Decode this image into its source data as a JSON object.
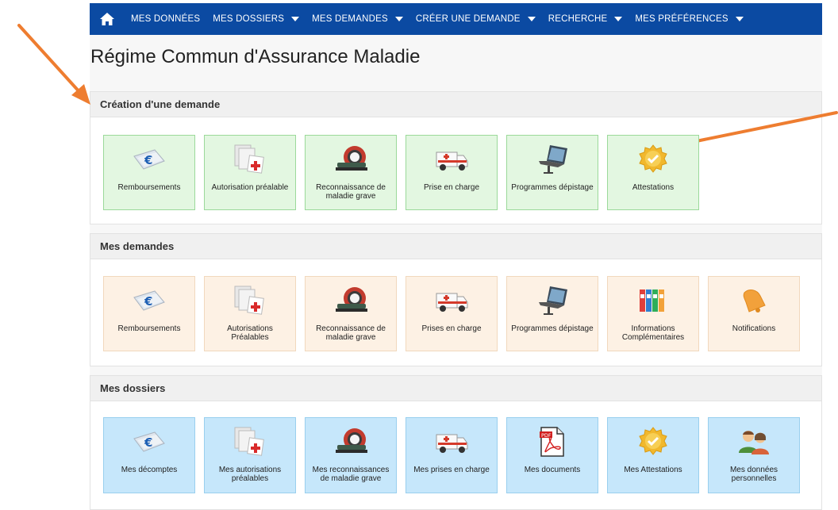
{
  "nav": {
    "home_icon": "home-icon",
    "items": [
      {
        "label": "MES DONNÉES",
        "dropdown": false
      },
      {
        "label": "MES DOSSIERS",
        "dropdown": true
      },
      {
        "label": "MES DEMANDES",
        "dropdown": true
      },
      {
        "label": "CRÉER UNE DEMANDE",
        "dropdown": true
      },
      {
        "label": "RECHERCHE",
        "dropdown": true
      },
      {
        "label": "MES PRÉFÉRENCES",
        "dropdown": true
      }
    ],
    "color": "#0b4aa2"
  },
  "page_title": "Régime Commun d'Assurance Maladie",
  "sections": [
    {
      "title": "Création d'une demande",
      "color": "green",
      "tiles": [
        {
          "label": "Remboursements",
          "icon": "euro-icon"
        },
        {
          "label": "Autorisation préalable",
          "icon": "documents-icon"
        },
        {
          "label": "Reconnaissance de maladie grave",
          "icon": "scanner-icon"
        },
        {
          "label": "Prise en charge",
          "icon": "ambulance-icon"
        },
        {
          "label": "Programmes dépistage",
          "icon": "laptop-icon"
        },
        {
          "label": "Attestations",
          "icon": "badge-icon"
        }
      ]
    },
    {
      "title": "Mes demandes",
      "color": "peach",
      "tiles": [
        {
          "label": "Remboursements",
          "icon": "euro-icon"
        },
        {
          "label": "Autorisations Préalables",
          "icon": "documents-icon"
        },
        {
          "label": "Reconnaissance de maladie grave",
          "icon": "scanner-icon"
        },
        {
          "label": "Prises en charge",
          "icon": "ambulance-icon"
        },
        {
          "label": "Programmes dépistage",
          "icon": "laptop-icon"
        },
        {
          "label": "Informations Complémentaires",
          "icon": "binders-icon"
        },
        {
          "label": "Notifications",
          "icon": "bell-icon"
        }
      ]
    },
    {
      "title": "Mes dossiers",
      "color": "blue",
      "tiles": [
        {
          "label": "Mes décomptes",
          "icon": "euro-icon"
        },
        {
          "label": "Mes autorisations préalables",
          "icon": "documents-icon"
        },
        {
          "label": "Mes reconnaissances de maladie grave",
          "icon": "scanner-icon"
        },
        {
          "label": "Mes prises en charge",
          "icon": "ambulance-icon"
        },
        {
          "label": "Mes documents",
          "icon": "pdf-icon"
        },
        {
          "label": "Mes Attestations",
          "icon": "badge-icon"
        },
        {
          "label": "Mes données personnelles",
          "icon": "users-icon"
        }
      ]
    }
  ],
  "annotation_color": "#ee7d30"
}
